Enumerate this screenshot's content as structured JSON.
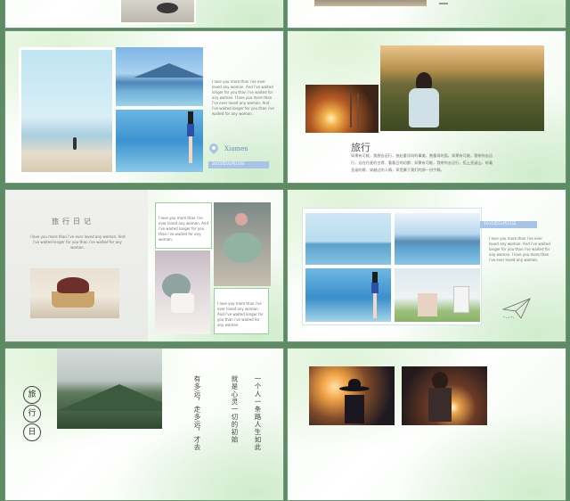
{
  "colors": {
    "accent_blue": "#a7c3e6",
    "accent_green": "#8fd48a",
    "slide_border": "#6d9a73"
  },
  "slide2": {
    "paragraph": "I love you more than i've ever loved any woman. And i've waited longer for you than i've waited for any woman. I love you more than i've ever loved any woman. And i've waited longer for you than i've waited for any woman.",
    "location": "Xiamen",
    "date": "2015年01月15日",
    "location_icon": "map-pin-icon"
  },
  "slide3": {
    "title": "旅行",
    "paragraph": "如果有可能，我想去远行，独赴重洋间的事美，数量再的面。如果有可能，我带你去远行，远在丹麦的古得、看看日的初都；如果有可能，我带你去远行，搭上圣诞山，听着圣诞的歌、穿越过的人情，享受属于我们的那一份宁静。"
  },
  "slide4": {
    "title": "旅行日记",
    "paragraph": "I love you more than i've ever loved any woman. And i've waited longer for you than i've waited for any woman.",
    "box1": "I love you more than i've ever loved any woman. And i've waited longer for you than i've waited for any woman.",
    "box2": "I love you more than i've ever loved any woman. And i've waited longer for you than i've waited for any woman."
  },
  "slide5": {
    "date": "2015年01月15日",
    "paragraph": "I love you more than i've ever loved any woman. And i've waited longer for you than i've waited for any woman. I love you more than i've ever loved any woman.",
    "plane_icon": "paper-plane-icon"
  },
  "slide6": {
    "circle_chars": [
      "旅",
      "行",
      "日"
    ],
    "columns": [
      "一个人一条路人生如此",
      "就是心灵一切的初始",
      "有多远，走多远，才去"
    ]
  }
}
